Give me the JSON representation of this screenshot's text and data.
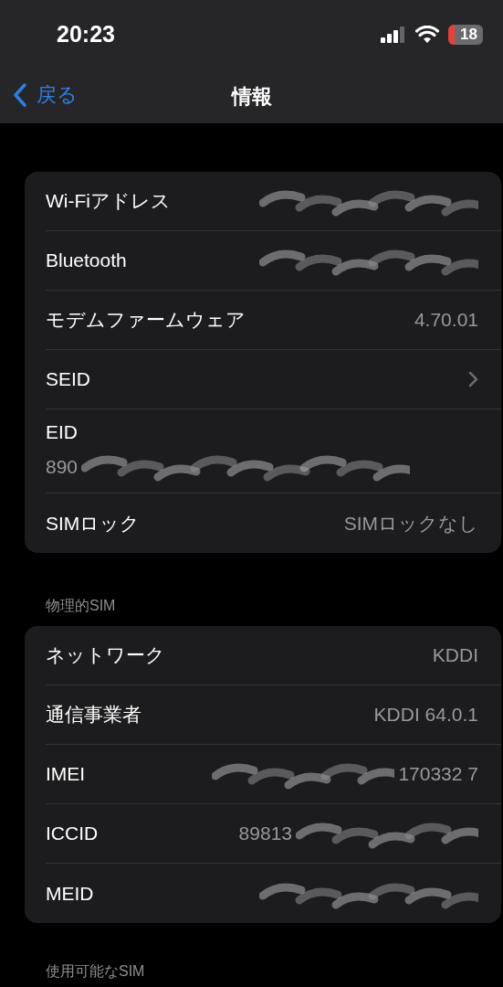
{
  "status_bar": {
    "time": "20:23",
    "battery": "18"
  },
  "nav": {
    "back": "戻る",
    "title": "情報"
  },
  "groups": [
    {
      "rows": [
        {
          "kind": "redacted",
          "label": "Wi-Fiアドレス"
        },
        {
          "kind": "redacted",
          "label": "Bluetooth"
        },
        {
          "kind": "value",
          "label": "モデムファームウェア",
          "value": "4.70.01"
        },
        {
          "kind": "chevron",
          "label": "SEID"
        },
        {
          "kind": "stacked",
          "label": "EID",
          "visible": "890"
        },
        {
          "kind": "value",
          "label": "SIMロック",
          "value": "SIMロックなし"
        }
      ]
    },
    {
      "header": "物理的SIM",
      "rows": [
        {
          "kind": "value",
          "label": "ネットワーク",
          "value": "KDDI"
        },
        {
          "kind": "value",
          "label": "通信事業者",
          "value": "KDDI 64.0.1"
        },
        {
          "kind": "redacted",
          "label": "IMEI",
          "visible": "170332 7"
        },
        {
          "kind": "redacted_lead",
          "label": "ICCID",
          "visible": "89813"
        },
        {
          "kind": "redacted",
          "label": "MEID"
        }
      ]
    }
  ],
  "footer_header": "使用可能なSIM"
}
